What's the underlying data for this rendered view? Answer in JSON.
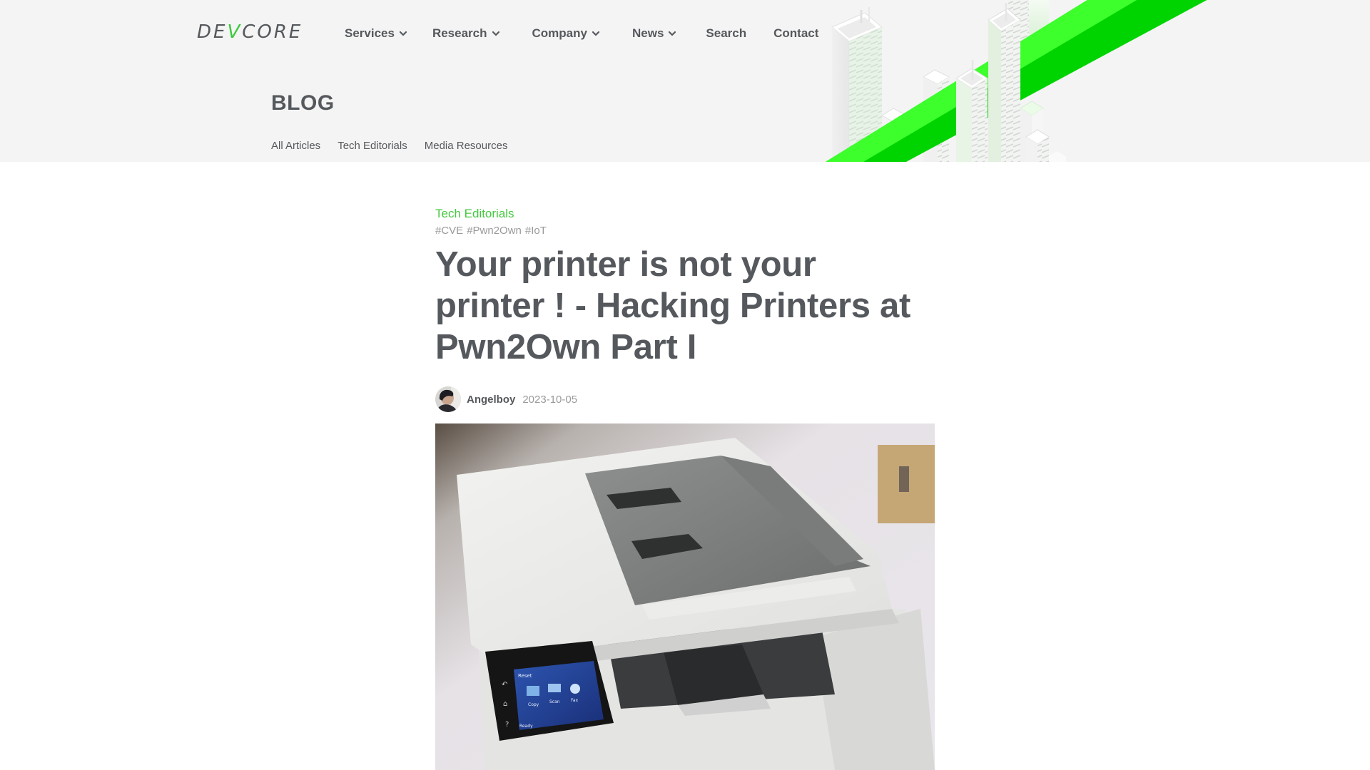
{
  "brand": {
    "logo_before": "DE",
    "logo_v": "V",
    "logo_after": "CORE",
    "accent_color": "#3cc93c"
  },
  "nav": {
    "items": [
      {
        "label": "Services",
        "has_dropdown": true,
        "icon": "chevron-down-icon"
      },
      {
        "label": "Research",
        "has_dropdown": true,
        "icon": "chevron-down-icon"
      },
      {
        "label": "Company",
        "has_dropdown": true,
        "icon": "chevron-down-icon"
      },
      {
        "label": "News",
        "has_dropdown": true,
        "icon": "chevron-down-icon"
      },
      {
        "label": "Search",
        "has_dropdown": false
      },
      {
        "label": "Contact",
        "has_dropdown": false
      }
    ]
  },
  "blog": {
    "title": "BLOG",
    "subnav": [
      "All Articles",
      "Tech Editorials",
      "Media Resources"
    ]
  },
  "article": {
    "category": "Tech Editorials",
    "category_color": "#46c840",
    "tags": [
      "#CVE",
      "#Pwn2Own",
      "#IoT"
    ],
    "title": "Your printer is not your printer ! - Hacking Printers at Pwn2Own Part I",
    "author": "Angelboy",
    "date": "2023-10-05",
    "hero_image": {
      "subject": "multifunction-printer-photo",
      "screen_labels": {
        "header": "Reset",
        "copy": "Copy",
        "scan": "Scan",
        "fax": "Fax",
        "status": "Ready"
      }
    }
  }
}
